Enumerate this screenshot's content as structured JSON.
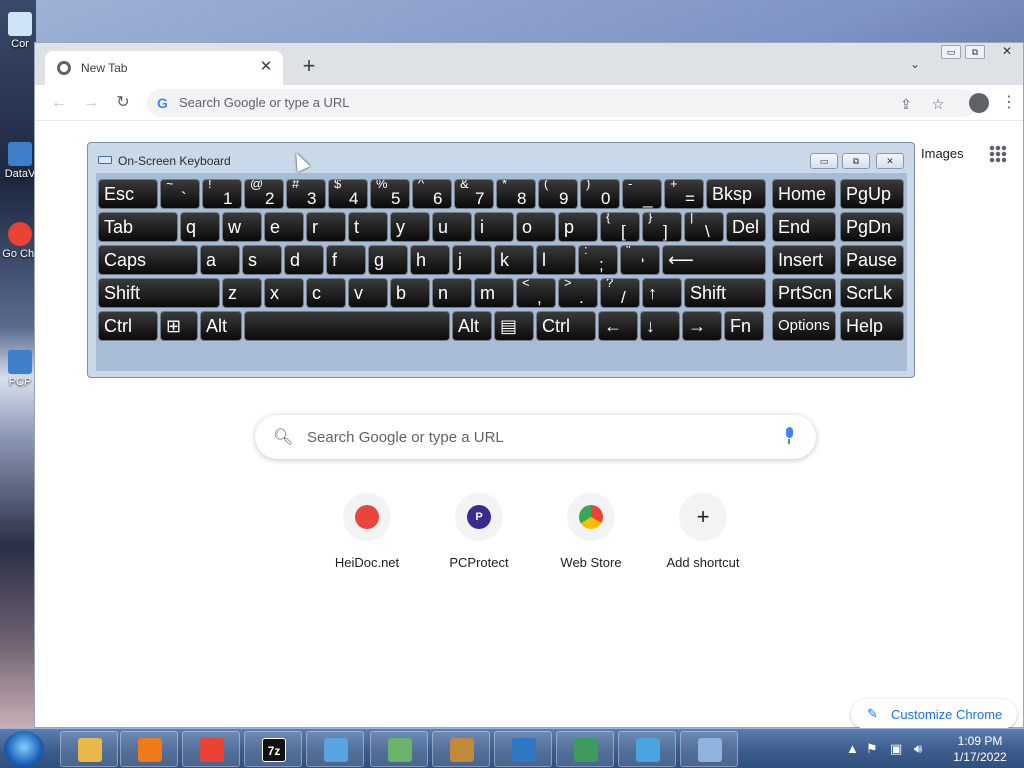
{
  "desktop": {
    "icons": [
      {
        "label": "Cor"
      },
      {
        "label": "DataV"
      },
      {
        "label": "Go Chr"
      },
      {
        "label": "PCP"
      }
    ]
  },
  "chrome": {
    "tab_title": "New Tab",
    "omnibox_placeholder": "Search Google or type a URL",
    "images_link": "Images",
    "search_placeholder": "Search Google or type a URL",
    "shortcuts": [
      {
        "label": "HeiDoc.net",
        "icon": "heidoc-icon",
        "color": "#e8453c"
      },
      {
        "label": "PCProtect",
        "icon": "pcprotect-icon",
        "color": "#3b2a8f",
        "letter": "P"
      },
      {
        "label": "Web Store",
        "icon": "web-store-icon",
        "color": "#ea4335"
      },
      {
        "label": "Add shortcut",
        "icon": "plus-icon",
        "color": "#202124",
        "letter": "+"
      }
    ],
    "customize_label": "Customize Chrome"
  },
  "osk": {
    "title": "On-Screen Keyboard",
    "keys": [
      {
        "label": "Esc"
      },
      {
        "top": "~",
        "bottom": "`"
      },
      {
        "top": "!",
        "bottom": "1"
      },
      {
        "top": "@",
        "bottom": "2"
      },
      {
        "top": "#",
        "bottom": "3"
      },
      {
        "top": "$",
        "bottom": "4"
      },
      {
        "top": "%",
        "bottom": "5"
      },
      {
        "top": "^",
        "bottom": "6"
      },
      {
        "top": "&",
        "bottom": "7"
      },
      {
        "top": "*",
        "bottom": "8"
      },
      {
        "top": "(",
        "bottom": "9"
      },
      {
        "top": ")",
        "bottom": "0"
      },
      {
        "top": "-",
        "bottom": "_"
      },
      {
        "top": "+",
        "bottom": "="
      },
      {
        "label": "Bksp"
      },
      {
        "label": "Home"
      },
      {
        "label": "PgUp"
      },
      {
        "label": "Tab"
      },
      {
        "label": "q"
      },
      {
        "label": "w"
      },
      {
        "label": "e"
      },
      {
        "label": "r"
      },
      {
        "label": "t"
      },
      {
        "label": "y"
      },
      {
        "label": "u"
      },
      {
        "label": "i"
      },
      {
        "label": "o"
      },
      {
        "label": "p"
      },
      {
        "top": "{",
        "bottom": "["
      },
      {
        "top": "}",
        "bottom": "]"
      },
      {
        "top": "|",
        "bottom": "\\"
      },
      {
        "label": "Del"
      },
      {
        "label": "End"
      },
      {
        "label": "PgDn"
      },
      {
        "label": "Caps"
      },
      {
        "label": "a"
      },
      {
        "label": "s"
      },
      {
        "label": "d"
      },
      {
        "label": "f"
      },
      {
        "label": "g"
      },
      {
        "label": "h"
      },
      {
        "label": "j"
      },
      {
        "label": "k"
      },
      {
        "label": "l"
      },
      {
        "top": ":",
        "bottom": ";"
      },
      {
        "top": "\"",
        "bottom": "'"
      },
      {
        "label": "⟵"
      },
      {
        "label": "Insert"
      },
      {
        "label": "Pause"
      },
      {
        "label": "Shift"
      },
      {
        "label": "z"
      },
      {
        "label": "x"
      },
      {
        "label": "c"
      },
      {
        "label": "v"
      },
      {
        "label": "b"
      },
      {
        "label": "n"
      },
      {
        "label": "m"
      },
      {
        "top": "<",
        "bottom": ","
      },
      {
        "top": ">",
        "bottom": "."
      },
      {
        "top": "?",
        "bottom": "/"
      },
      {
        "label": "↑"
      },
      {
        "label": "Shift"
      },
      {
        "label": "PrtScn"
      },
      {
        "label": "ScrLk"
      },
      {
        "label": "Ctrl"
      },
      {
        "label": "⊞"
      },
      {
        "label": "Alt"
      },
      {
        "label": ""
      },
      {
        "label": "Alt"
      },
      {
        "label": "▤"
      },
      {
        "label": "Ctrl"
      },
      {
        "label": "←"
      },
      {
        "label": "↓"
      },
      {
        "label": "→"
      },
      {
        "label": "Fn"
      },
      {
        "label": "Options"
      },
      {
        "label": "Help"
      }
    ]
  },
  "taskbar": {
    "items": [
      {
        "icon": "file-explorer-icon",
        "color": "#e8b84a"
      },
      {
        "icon": "media-player-icon",
        "color": "#f07a1a"
      },
      {
        "icon": "chrome-icon",
        "color": "#ea4335"
      },
      {
        "icon": "seven-zip-icon",
        "color": "#111111",
        "letter": "7z"
      },
      {
        "icon": "control-panel-icon",
        "color": "#5aa2e0"
      },
      {
        "icon": "disk-cleanup-icon",
        "color": "#6bb36b"
      },
      {
        "icon": "archive-app-icon",
        "color": "#c08a3a"
      },
      {
        "icon": "network-app-icon",
        "color": "#2f78c4"
      },
      {
        "icon": "system-monitor-icon",
        "color": "#3e9b5e"
      },
      {
        "icon": "sync-center-icon",
        "color": "#4aa3df"
      },
      {
        "icon": "on-screen-keyboard-icon",
        "color": "#8fb3dd"
      }
    ],
    "time": "1:09 PM",
    "date": "1/17/2022"
  }
}
